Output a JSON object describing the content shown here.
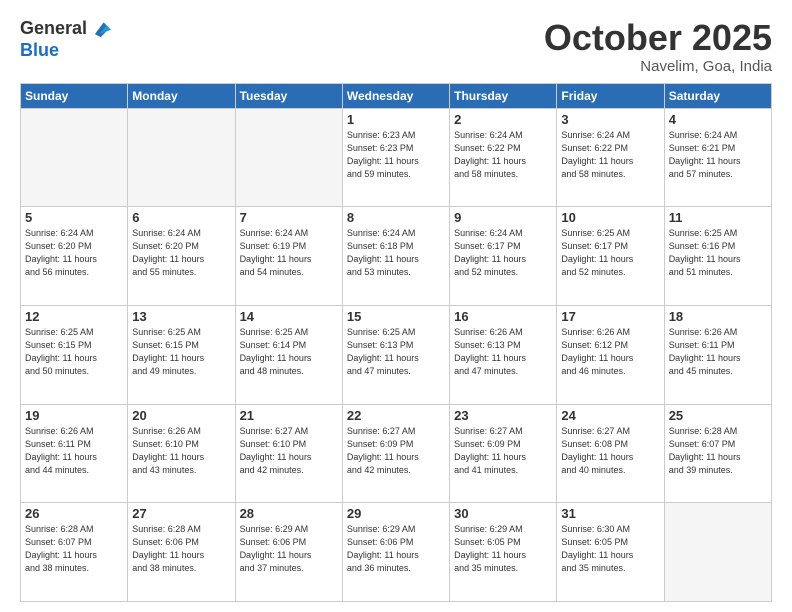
{
  "header": {
    "logo_general": "General",
    "logo_blue": "Blue",
    "month": "October 2025",
    "location": "Navelim, Goa, India"
  },
  "weekdays": [
    "Sunday",
    "Monday",
    "Tuesday",
    "Wednesday",
    "Thursday",
    "Friday",
    "Saturday"
  ],
  "weeks": [
    [
      {
        "day": "",
        "info": ""
      },
      {
        "day": "",
        "info": ""
      },
      {
        "day": "",
        "info": ""
      },
      {
        "day": "1",
        "info": "Sunrise: 6:23 AM\nSunset: 6:23 PM\nDaylight: 11 hours\nand 59 minutes."
      },
      {
        "day": "2",
        "info": "Sunrise: 6:24 AM\nSunset: 6:22 PM\nDaylight: 11 hours\nand 58 minutes."
      },
      {
        "day": "3",
        "info": "Sunrise: 6:24 AM\nSunset: 6:22 PM\nDaylight: 11 hours\nand 58 minutes."
      },
      {
        "day": "4",
        "info": "Sunrise: 6:24 AM\nSunset: 6:21 PM\nDaylight: 11 hours\nand 57 minutes."
      }
    ],
    [
      {
        "day": "5",
        "info": "Sunrise: 6:24 AM\nSunset: 6:20 PM\nDaylight: 11 hours\nand 56 minutes."
      },
      {
        "day": "6",
        "info": "Sunrise: 6:24 AM\nSunset: 6:20 PM\nDaylight: 11 hours\nand 55 minutes."
      },
      {
        "day": "7",
        "info": "Sunrise: 6:24 AM\nSunset: 6:19 PM\nDaylight: 11 hours\nand 54 minutes."
      },
      {
        "day": "8",
        "info": "Sunrise: 6:24 AM\nSunset: 6:18 PM\nDaylight: 11 hours\nand 53 minutes."
      },
      {
        "day": "9",
        "info": "Sunrise: 6:24 AM\nSunset: 6:17 PM\nDaylight: 11 hours\nand 52 minutes."
      },
      {
        "day": "10",
        "info": "Sunrise: 6:25 AM\nSunset: 6:17 PM\nDaylight: 11 hours\nand 52 minutes."
      },
      {
        "day": "11",
        "info": "Sunrise: 6:25 AM\nSunset: 6:16 PM\nDaylight: 11 hours\nand 51 minutes."
      }
    ],
    [
      {
        "day": "12",
        "info": "Sunrise: 6:25 AM\nSunset: 6:15 PM\nDaylight: 11 hours\nand 50 minutes."
      },
      {
        "day": "13",
        "info": "Sunrise: 6:25 AM\nSunset: 6:15 PM\nDaylight: 11 hours\nand 49 minutes."
      },
      {
        "day": "14",
        "info": "Sunrise: 6:25 AM\nSunset: 6:14 PM\nDaylight: 11 hours\nand 48 minutes."
      },
      {
        "day": "15",
        "info": "Sunrise: 6:25 AM\nSunset: 6:13 PM\nDaylight: 11 hours\nand 47 minutes."
      },
      {
        "day": "16",
        "info": "Sunrise: 6:26 AM\nSunset: 6:13 PM\nDaylight: 11 hours\nand 47 minutes."
      },
      {
        "day": "17",
        "info": "Sunrise: 6:26 AM\nSunset: 6:12 PM\nDaylight: 11 hours\nand 46 minutes."
      },
      {
        "day": "18",
        "info": "Sunrise: 6:26 AM\nSunset: 6:11 PM\nDaylight: 11 hours\nand 45 minutes."
      }
    ],
    [
      {
        "day": "19",
        "info": "Sunrise: 6:26 AM\nSunset: 6:11 PM\nDaylight: 11 hours\nand 44 minutes."
      },
      {
        "day": "20",
        "info": "Sunrise: 6:26 AM\nSunset: 6:10 PM\nDaylight: 11 hours\nand 43 minutes."
      },
      {
        "day": "21",
        "info": "Sunrise: 6:27 AM\nSunset: 6:10 PM\nDaylight: 11 hours\nand 42 minutes."
      },
      {
        "day": "22",
        "info": "Sunrise: 6:27 AM\nSunset: 6:09 PM\nDaylight: 11 hours\nand 42 minutes."
      },
      {
        "day": "23",
        "info": "Sunrise: 6:27 AM\nSunset: 6:09 PM\nDaylight: 11 hours\nand 41 minutes."
      },
      {
        "day": "24",
        "info": "Sunrise: 6:27 AM\nSunset: 6:08 PM\nDaylight: 11 hours\nand 40 minutes."
      },
      {
        "day": "25",
        "info": "Sunrise: 6:28 AM\nSunset: 6:07 PM\nDaylight: 11 hours\nand 39 minutes."
      }
    ],
    [
      {
        "day": "26",
        "info": "Sunrise: 6:28 AM\nSunset: 6:07 PM\nDaylight: 11 hours\nand 38 minutes."
      },
      {
        "day": "27",
        "info": "Sunrise: 6:28 AM\nSunset: 6:06 PM\nDaylight: 11 hours\nand 38 minutes."
      },
      {
        "day": "28",
        "info": "Sunrise: 6:29 AM\nSunset: 6:06 PM\nDaylight: 11 hours\nand 37 minutes."
      },
      {
        "day": "29",
        "info": "Sunrise: 6:29 AM\nSunset: 6:06 PM\nDaylight: 11 hours\nand 36 minutes."
      },
      {
        "day": "30",
        "info": "Sunrise: 6:29 AM\nSunset: 6:05 PM\nDaylight: 11 hours\nand 35 minutes."
      },
      {
        "day": "31",
        "info": "Sunrise: 6:30 AM\nSunset: 6:05 PM\nDaylight: 11 hours\nand 35 minutes."
      },
      {
        "day": "",
        "info": ""
      }
    ]
  ]
}
